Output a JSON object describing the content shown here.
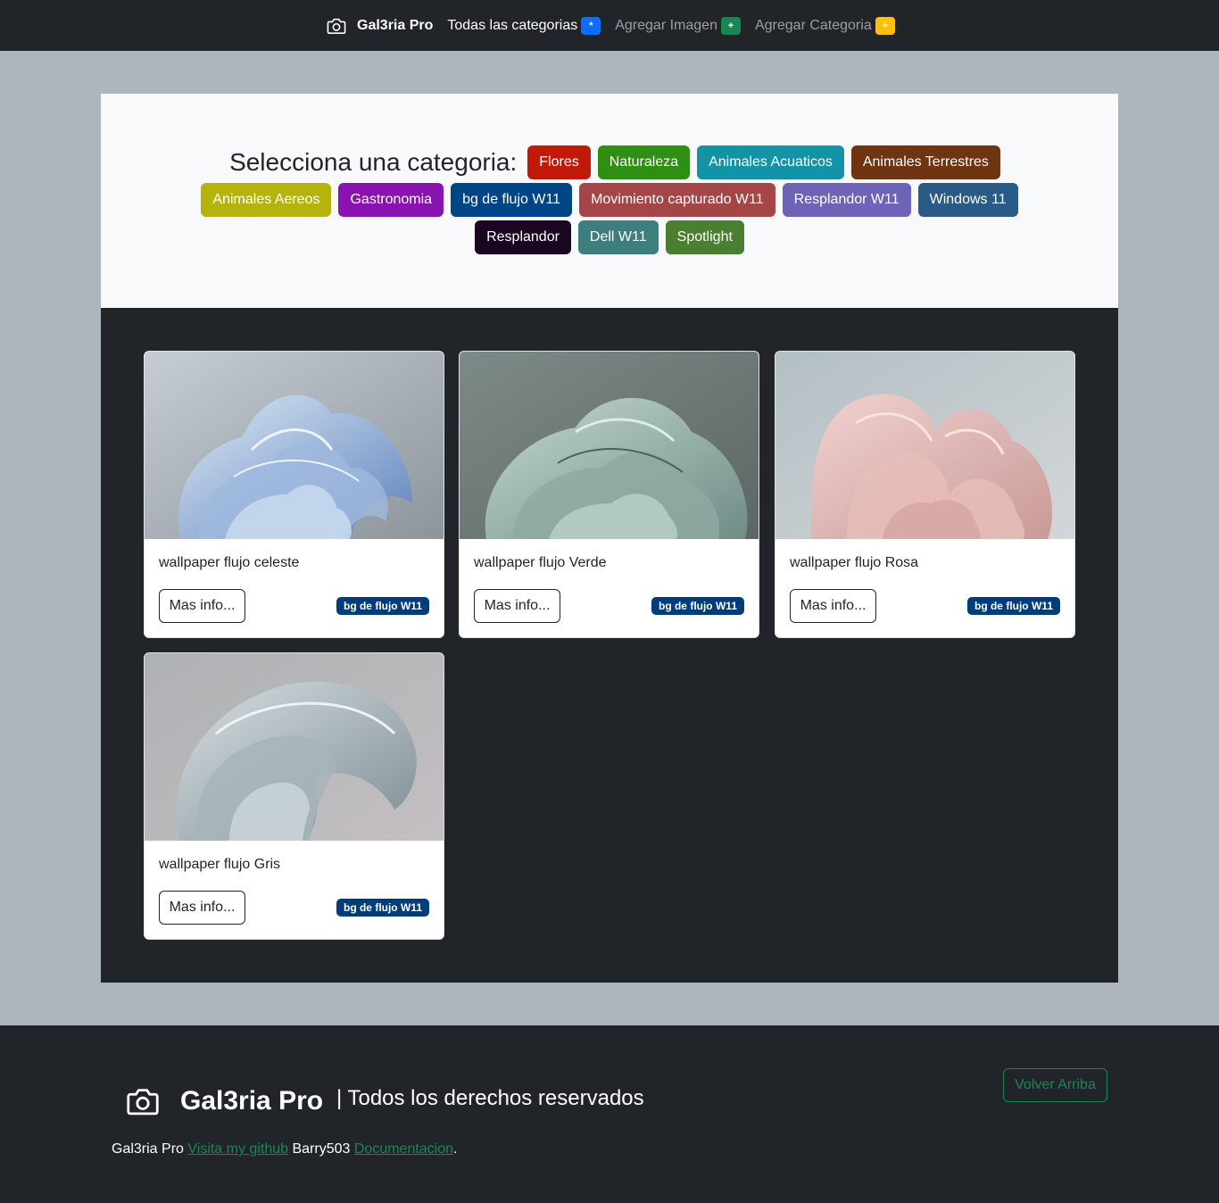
{
  "navbar": {
    "brand": "Gal3ria Pro",
    "links": [
      {
        "label": "Todas las categorias",
        "badge": "*",
        "badge_color": "#0d6efd"
      },
      {
        "label": "Agregar Imagen",
        "badge": "+",
        "badge_color": "#198754"
      },
      {
        "label": "Agregar Categoria",
        "badge": "+",
        "badge_color": "#ffc107"
      }
    ]
  },
  "categories": {
    "title": "Selecciona una categoria:",
    "items": [
      {
        "label": "Flores",
        "color": "#c11a0a"
      },
      {
        "label": "Naturaleza",
        "color": "#2e8f13"
      },
      {
        "label": "Animales Acuaticos",
        "color": "#1393a7"
      },
      {
        "label": "Animales Terrestres",
        "color": "#6f3410"
      },
      {
        "label": "Animales Aereos",
        "color": "#b5b40e"
      },
      {
        "label": "Gastronomia",
        "color": "#8a12b0"
      },
      {
        "label": "bg de flujo W11",
        "color": "#004586"
      },
      {
        "label": "Movimiento capturado W11",
        "color": "#a44547"
      },
      {
        "label": "Resplandor W11",
        "color": "#6d64b8"
      },
      {
        "label": "Windows 11",
        "color": "#2a5b86"
      },
      {
        "label": "Resplandor",
        "color": "#1b0622"
      },
      {
        "label": "Dell W11",
        "color": "#3f7e7e"
      },
      {
        "label": "Spotlight",
        "color": "#4a7f31"
      }
    ]
  },
  "cards": [
    {
      "title": "wallpaper flujo celeste",
      "button": "Mas info...",
      "badge": "bg de flujo W11",
      "image": "blue-flow-wallpaper"
    },
    {
      "title": "wallpaper flujo Verde",
      "button": "Mas info...",
      "badge": "bg de flujo W11",
      "image": "green-flow-wallpaper"
    },
    {
      "title": "wallpaper flujo Rosa",
      "button": "Mas info...",
      "badge": "bg de flujo W11",
      "image": "pink-flow-wallpaper"
    },
    {
      "title": "wallpaper flujo Gris",
      "button": "Mas info...",
      "badge": "bg de flujo W11",
      "image": "gray-flow-wallpaper"
    }
  ],
  "footer": {
    "brand": "Gal3ria Pro",
    "rights": "| Todos los derechos reservados",
    "back_to_top": "Volver Arriba",
    "line_prefix": "Gal3ria Pro",
    "github_link": "Visita my github",
    "user": "Barry503",
    "docs_link": "Documentacion",
    "line_suffix": "."
  }
}
